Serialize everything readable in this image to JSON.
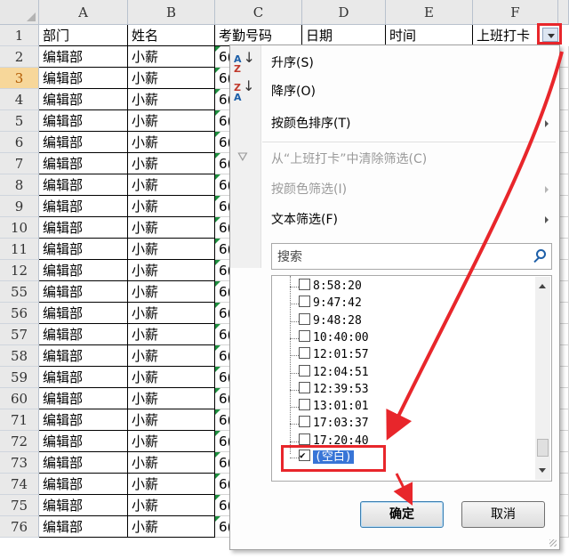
{
  "sheet": {
    "columns": [
      "A",
      "B",
      "C",
      "D",
      "E",
      "F"
    ],
    "header_row": {
      "num": "1",
      "cells": [
        "部门",
        "姓名",
        "考勤号码",
        "日期",
        "时间",
        "上班打卡"
      ]
    },
    "rows": [
      {
        "num": "2",
        "dept": "编辑部",
        "name": "小薪",
        "code": "6("
      },
      {
        "num": "3",
        "dept": "编辑部",
        "name": "小薪",
        "code": "6("
      },
      {
        "num": "4",
        "dept": "编辑部",
        "name": "小薪",
        "code": "6("
      },
      {
        "num": "5",
        "dept": "编辑部",
        "name": "小薪",
        "code": "6("
      },
      {
        "num": "6",
        "dept": "编辑部",
        "name": "小薪",
        "code": "6("
      },
      {
        "num": "7",
        "dept": "编辑部",
        "name": "小薪",
        "code": "6("
      },
      {
        "num": "8",
        "dept": "编辑部",
        "name": "小薪",
        "code": "6("
      },
      {
        "num": "9",
        "dept": "编辑部",
        "name": "小薪",
        "code": "6("
      },
      {
        "num": "10",
        "dept": "编辑部",
        "name": "小薪",
        "code": "6("
      },
      {
        "num": "11",
        "dept": "编辑部",
        "name": "小薪",
        "code": "6("
      },
      {
        "num": "12",
        "dept": "编辑部",
        "name": "小薪",
        "code": "6("
      },
      {
        "num": "55",
        "dept": "编辑部",
        "name": "小薪",
        "code": "6("
      },
      {
        "num": "56",
        "dept": "编辑部",
        "name": "小薪",
        "code": "6("
      },
      {
        "num": "57",
        "dept": "编辑部",
        "name": "小薪",
        "code": "6("
      },
      {
        "num": "58",
        "dept": "编辑部",
        "name": "小薪",
        "code": "6("
      },
      {
        "num": "59",
        "dept": "编辑部",
        "name": "小薪",
        "code": "6("
      },
      {
        "num": "60",
        "dept": "编辑部",
        "name": "小薪",
        "code": "6("
      },
      {
        "num": "71",
        "dept": "编辑部",
        "name": "小薪",
        "code": "6("
      },
      {
        "num": "72",
        "dept": "编辑部",
        "name": "小薪",
        "code": "6("
      },
      {
        "num": "73",
        "dept": "编辑部",
        "name": "小薪",
        "code": "6("
      },
      {
        "num": "74",
        "dept": "编辑部",
        "name": "小薪",
        "code": "6("
      },
      {
        "num": "75",
        "dept": "编辑部",
        "name": "小薪",
        "code": "6("
      },
      {
        "num": "76",
        "dept": "编辑部",
        "name": "小薪",
        "code": "6("
      }
    ],
    "selected_row": "3"
  },
  "menu": {
    "sort_asc": "升序(S)",
    "sort_desc": "降序(O)",
    "sort_color": "按颜色排序(T)",
    "clear_filter": "从“上班打卡”中清除筛选(C)",
    "filter_color": "按颜色筛选(I)",
    "text_filter": "文本筛选(F)",
    "search_placeholder": "搜索",
    "values": [
      {
        "label": "8:58:20",
        "checked": false
      },
      {
        "label": "9:47:42",
        "checked": false
      },
      {
        "label": "9:48:28",
        "checked": false
      },
      {
        "label": "10:40:00",
        "checked": false
      },
      {
        "label": "12:01:57",
        "checked": false
      },
      {
        "label": "12:04:51",
        "checked": false
      },
      {
        "label": "12:39:53",
        "checked": false
      },
      {
        "label": "13:01:01",
        "checked": false
      },
      {
        "label": "17:03:37",
        "checked": false
      },
      {
        "label": "17:20:40",
        "checked": false
      },
      {
        "label": "(空白)",
        "checked": true
      }
    ],
    "ok_label": "确定",
    "cancel_label": "取消"
  },
  "colors": {
    "annotation": "#e8262b",
    "selection": "#3875d7"
  }
}
